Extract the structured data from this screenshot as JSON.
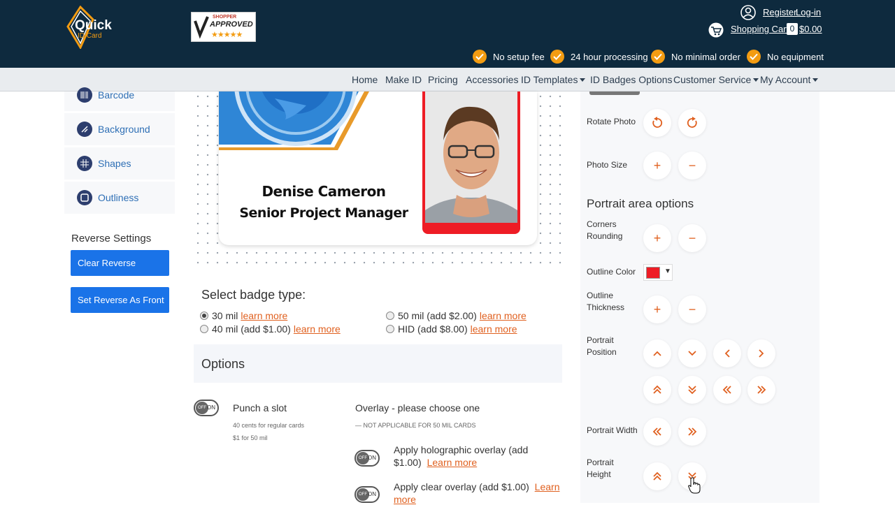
{
  "header": {
    "logo": {
      "line1": "Quick",
      "line2": "ID Card"
    },
    "shopper_approved": {
      "top": "SHOPPER",
      "main": "APPROVED",
      "stars": "★★★★★"
    },
    "register_label": "Register",
    "login_label": "Log-in",
    "cart_label": "Shopping Cart",
    "cart_count": "0",
    "cart_total": "$0.00",
    "features": [
      "No setup fee",
      "24 hour processing",
      "No minimal order",
      "No equipment"
    ]
  },
  "nav": {
    "items": [
      "Home",
      "Make ID",
      "Pricing",
      "Accessories",
      "ID Templates",
      "ID Badges Options",
      "Customer Service",
      "My Account"
    ]
  },
  "sidebar": {
    "items": [
      "Barcode",
      "Background",
      "Shapes",
      "Outliness"
    ],
    "reverse_title": "Reverse Settings",
    "clear_reverse": "Clear Reverse",
    "set_reverse": "Set Reverse As Front"
  },
  "card": {
    "name": "Denise Cameron",
    "title": "Senior Project Manager"
  },
  "badge": {
    "title": "Select badge type:",
    "options": [
      {
        "label": "30 mil",
        "link": "learn more",
        "selected": true
      },
      {
        "label": "40 mil (add $1.00)",
        "link": "learn more",
        "selected": false
      },
      {
        "label": "50 mil (add $2.00)",
        "link": "learn more",
        "selected": false
      },
      {
        "label": "HID (add $8.00)",
        "link": "learn more",
        "selected": false
      }
    ]
  },
  "options": {
    "title": "Options",
    "toggle_off": "OFF",
    "toggle_on": "ON",
    "punch_label": "Punch a slot",
    "punch_note1": "40 cents for regular cards",
    "punch_note2": "$1 for 50 mil",
    "overlay_title": "Overlay - please choose one",
    "overlay_note": "— NOT APPLICABLE FOR 50 MIL CARDS",
    "holo_label": "Apply holographic overlay (add",
    "holo_label2": "$1.00)",
    "holo_link": "Learn more",
    "clear_label": "Apply clear overlay (add $1.00)",
    "clear_link1": "Learn",
    "clear_link2": "more"
  },
  "right_panel": {
    "rotate_label": "Rotate Photo",
    "photo_size_label": "Photo Size",
    "portrait_title": "Portrait area options",
    "corners_label1": "Corners",
    "corners_label2": "Rounding",
    "outline_color_label": "Outline Color",
    "outline_color": "#ee1c25",
    "outline_thick1": "Outline",
    "outline_thick2": "Thickness",
    "portrait_pos1": "Portrait",
    "portrait_pos2": "Position",
    "portrait_width": "Portrait Width",
    "portrait_height1": "Portrait",
    "portrait_height2": "Height"
  },
  "colors": {
    "accent": "#e0601f",
    "brand": "#0e2a3e",
    "button": "#1a73e8",
    "check": "#f39c12"
  }
}
